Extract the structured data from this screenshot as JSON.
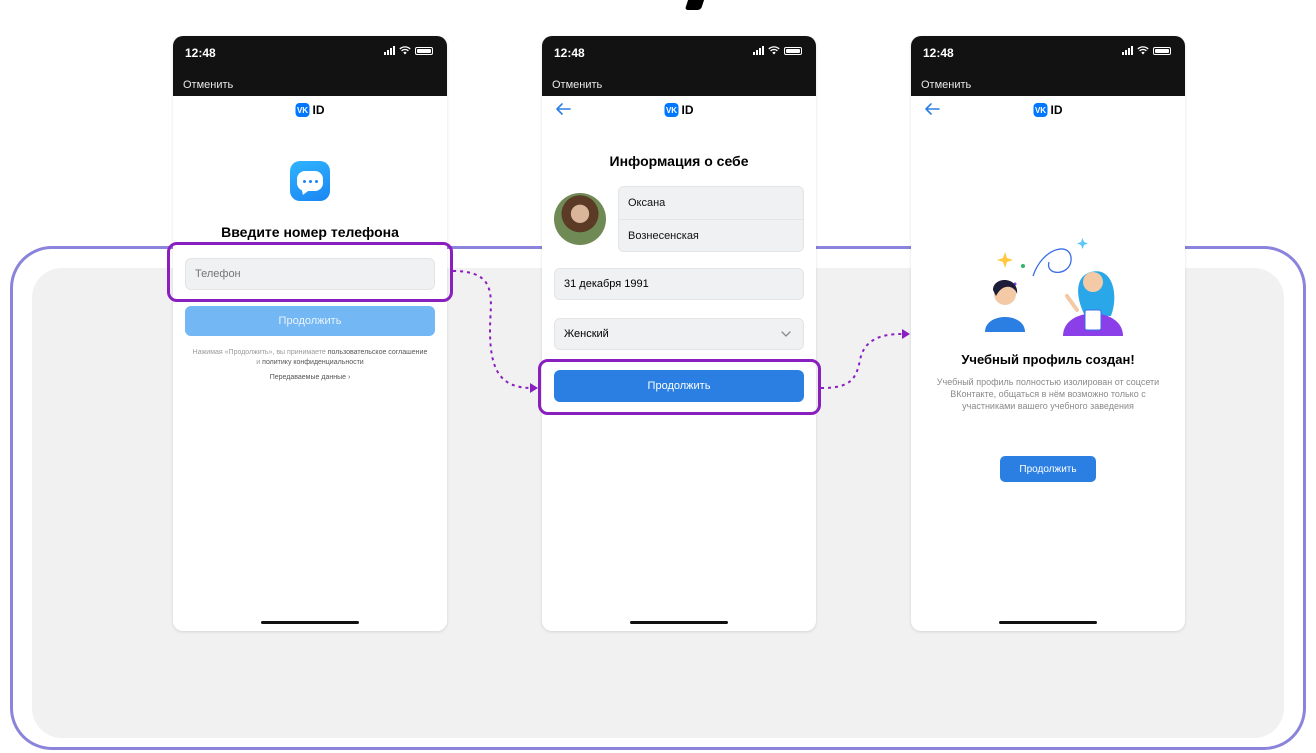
{
  "status_bar": {
    "time": "12:48",
    "cancel_label": "Отменить"
  },
  "brand": {
    "logo_badge": "VK",
    "logo_text": "ID",
    "accent_color": "#2b7fe3",
    "highlight_color": "#8a1fc0"
  },
  "screen_phone": {
    "title": "Введите номер телефона",
    "phone_placeholder": "Телефон",
    "continue_label": "Продолжить",
    "terms_prefix": "Нажимая «Продолжить», вы принимаете",
    "terms_link_agreement": "пользовательское соглашение",
    "terms_and": "и",
    "terms_link_privacy": "политику конфиденциальности",
    "transferred_data_label": "Передаваемые данные ›"
  },
  "screen_profile": {
    "title": "Информация о себе",
    "first_name": "Оксана",
    "last_name": "Вознесенская",
    "birth_date": "31 декабря 1991",
    "gender": "Женский",
    "continue_label": "Продолжить"
  },
  "screen_done": {
    "title": "Учебный профиль создан!",
    "description": "Учебный профиль полностью изолирован от соцсети ВКонтакте, общаться в нём возможно только с участниками вашего учебного заведения",
    "continue_label": "Продолжить"
  }
}
